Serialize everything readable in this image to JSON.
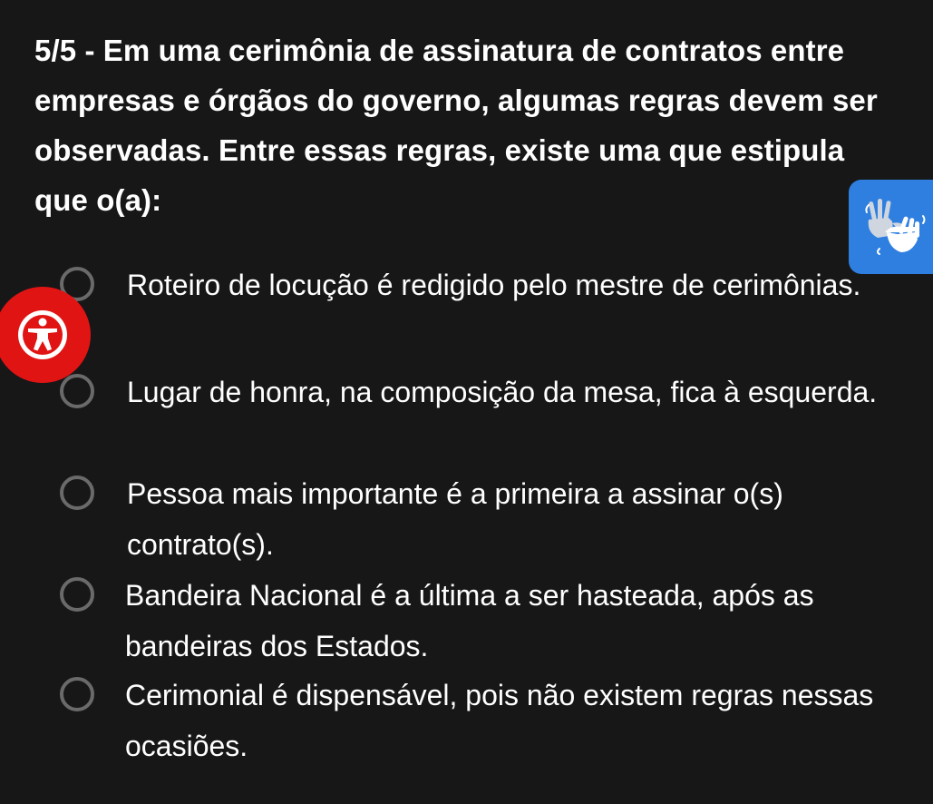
{
  "question": {
    "text": "5/5 - Em uma cerimônia de assinatura de contratos entre empresas e órgãos do governo, algumas regras devem ser observadas. Entre essas regras, existe uma que estipula que o(a):"
  },
  "options": [
    {
      "text": "Roteiro de locução é redigido pelo mestre de cerimônias."
    },
    {
      "text": "Lugar de honra, na composição da mesa, fica à esquerda."
    },
    {
      "text": "Pessoa mais importante é a primeira a assinar o(s) contrato(s)."
    },
    {
      "text": "Bandeira Nacional é a última a ser hasteada, após as bandeiras dos Estados."
    },
    {
      "text": "Cerimonial é dispensável, pois não existem regras nessas ocasiões."
    }
  ],
  "widgets": {
    "libras_icon": "sign-language-hands-icon",
    "accessibility_icon": "accessibility-person-icon"
  },
  "colors": {
    "background": "#171718",
    "text": "#ffffff",
    "radio_border": "#6a6a6a",
    "libras_blue": "#2f7fe0",
    "accessibility_red": "#e11414"
  }
}
